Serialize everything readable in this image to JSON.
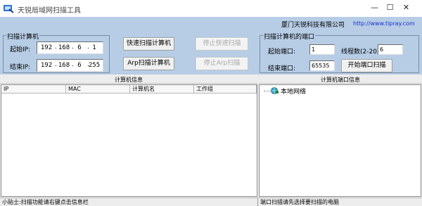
{
  "window": {
    "title": "天锐局域网扫描工具",
    "icon": "scanner-app-icon",
    "minimize_glyph": "—",
    "maximize_glyph": "☐",
    "close_glyph": "✕"
  },
  "header": {
    "company": "厦门天锐科技有限公司",
    "url": "http://www.tipray.com"
  },
  "scan_group": {
    "title": "扫描计算机",
    "start_ip_label": "起始IP:",
    "end_ip_label": "结束IP:",
    "start_ip": [
      "192",
      "168",
      "6",
      "1"
    ],
    "end_ip": [
      "192",
      "168",
      "6",
      "255"
    ],
    "dot": "."
  },
  "buttons": {
    "quick_scan": "快速扫描计算机",
    "stop_quick_scan": "停止快速扫描",
    "arp_scan": "Arp扫描计算机",
    "stop_arp_scan": "停止Arp扫描",
    "start_port_scan": "开始端口扫描"
  },
  "port_group": {
    "title": "扫描计算机的端口",
    "start_port_label": "起始端口:",
    "end_port_label": "结束端口:",
    "threads_label": "线程数(2-20):",
    "start_port": "1",
    "end_port": "65535",
    "threads": "6"
  },
  "computer_info": {
    "header": "计算机信息",
    "columns": [
      "IP",
      "MAC",
      "计算机名",
      "工作组"
    ],
    "rows": []
  },
  "port_info": {
    "header": "计算机端口信息",
    "tree_root": "本地网络",
    "tree_root_icon": "network-globe-icon"
  },
  "status": {
    "left": "小贴士:扫描功能请右键点击信息栏",
    "right": "端口扫描请先选择要扫描的电脑"
  },
  "colors": {
    "top_panel_bg": "#b7cde6",
    "url_link": "#1a2ecc",
    "disabled_text": "#a8a8a8"
  }
}
